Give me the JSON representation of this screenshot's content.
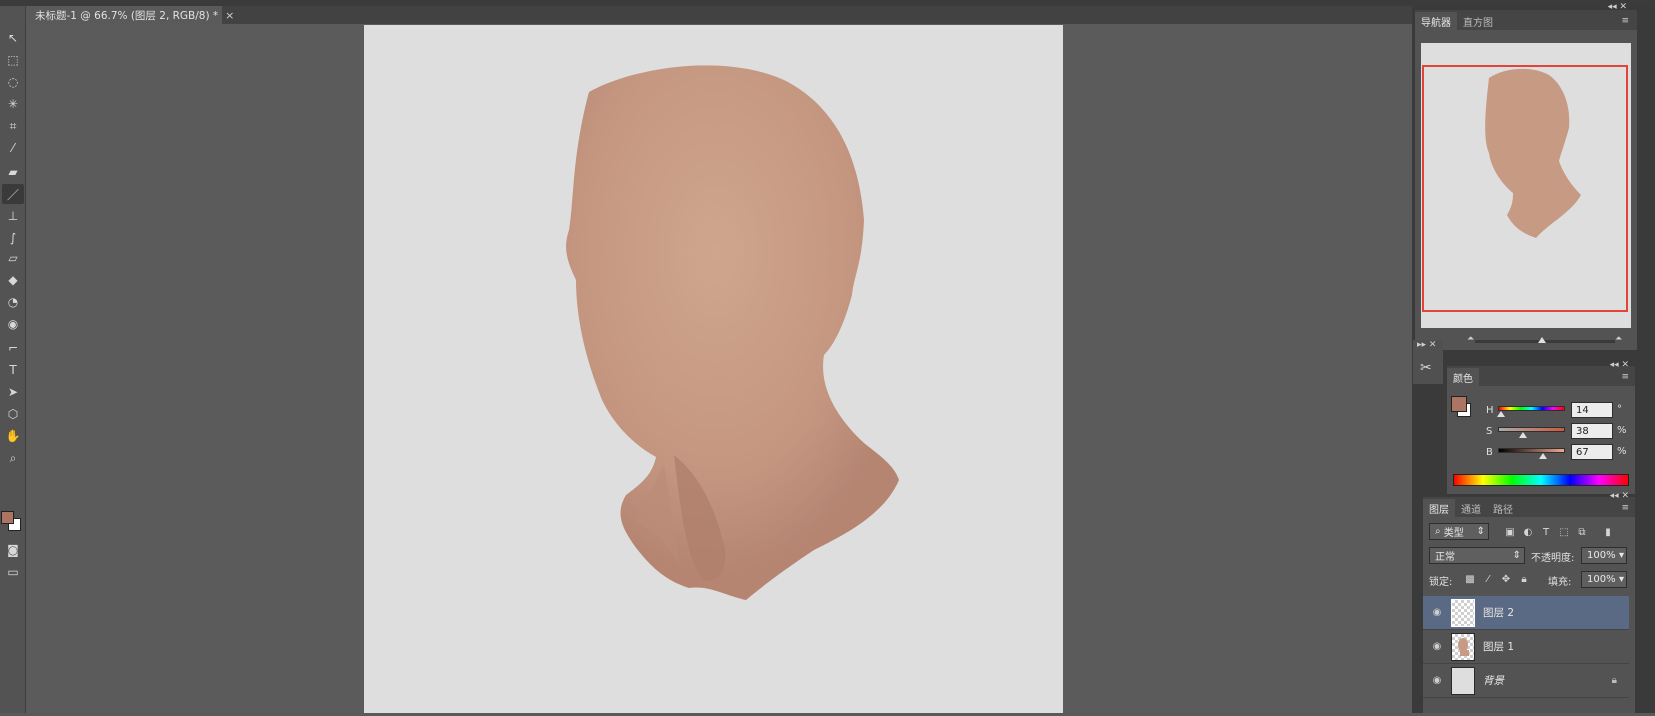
{
  "document_tab": {
    "title": "未标题-1 @ 66.7% (图层 2, RGB/8) *",
    "close": "×"
  },
  "tools": [
    {
      "name": "move-tool",
      "glyph": "↖"
    },
    {
      "name": "marquee-tool",
      "glyph": "⬚"
    },
    {
      "name": "lasso-tool",
      "glyph": "◌"
    },
    {
      "name": "magic-wand-tool",
      "glyph": "✳"
    },
    {
      "name": "crop-tool",
      "glyph": "⌗"
    },
    {
      "name": "eyedropper-tool",
      "glyph": "⁄"
    },
    {
      "name": "healing-brush-tool",
      "glyph": "▰"
    },
    {
      "name": "brush-tool",
      "glyph": "／"
    },
    {
      "name": "clone-stamp-tool",
      "glyph": "⊥"
    },
    {
      "name": "history-brush-tool",
      "glyph": "∫"
    },
    {
      "name": "eraser-tool",
      "glyph": "▱"
    },
    {
      "name": "paint-bucket-tool",
      "glyph": "◆"
    },
    {
      "name": "blur-tool",
      "glyph": "◔"
    },
    {
      "name": "dodge-tool",
      "glyph": "◉"
    },
    {
      "name": "pen-tool",
      "glyph": "⌐"
    },
    {
      "name": "type-tool",
      "glyph": "T"
    },
    {
      "name": "path-selection-tool",
      "glyph": "➤"
    },
    {
      "name": "shape-tool",
      "glyph": "⬡"
    },
    {
      "name": "hand-tool",
      "glyph": "✋"
    },
    {
      "name": "zoom-tool",
      "glyph": "⌕"
    }
  ],
  "colors": {
    "foreground": "#ab7463",
    "background": "#ffffff",
    "skin": "#c99b84",
    "skin_dark": "#b38472",
    "canvas": "#dedede"
  },
  "navigator": {
    "tabs": [
      "导航器",
      "直方图"
    ]
  },
  "color_panel": {
    "tab": "颜色",
    "rows": [
      {
        "label": "H",
        "value": "14",
        "unit": "°"
      },
      {
        "label": "S",
        "value": "38",
        "unit": "%"
      },
      {
        "label": "B",
        "value": "67",
        "unit": "%"
      }
    ]
  },
  "layers_panel": {
    "tabs": [
      "图层",
      "通道",
      "路径"
    ],
    "filter": "类型",
    "blend_mode": "正常",
    "opacity_label": "不透明度:",
    "opacity_value": "100%",
    "lock_label": "锁定:",
    "fill_label": "填充:",
    "fill_value": "100%",
    "layers": [
      {
        "name": "图层 2",
        "selected": true
      },
      {
        "name": "图层 1",
        "selected": false
      },
      {
        "name": "背景",
        "selected": false
      }
    ]
  }
}
